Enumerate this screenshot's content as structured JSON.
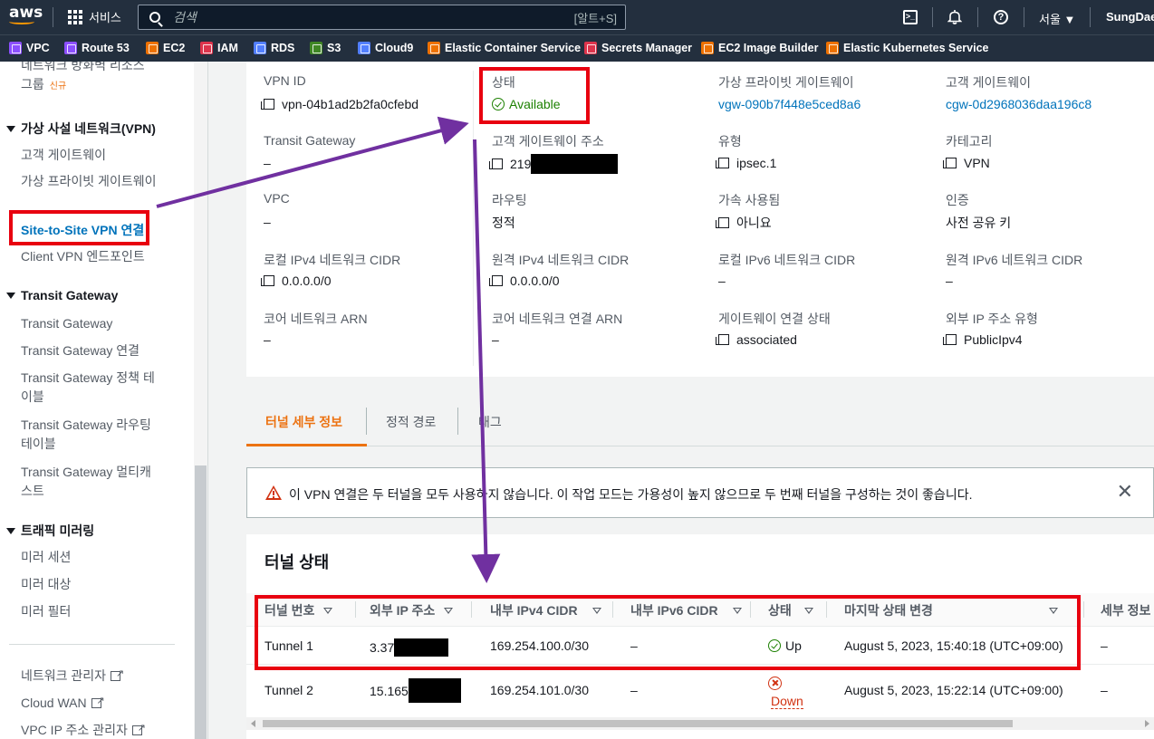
{
  "topnav": {
    "logo": "aws",
    "services_label": "서비스",
    "search_placeholder": "검색",
    "search_shortcut": "[알트+S]",
    "region": "서울 ▼",
    "user": "SungDae,"
  },
  "favorites": [
    {
      "label": "VPC",
      "color": "#8c4fff"
    },
    {
      "label": "Route 53",
      "color": "#8c4fff"
    },
    {
      "label": "EC2",
      "color": "#ed7100"
    },
    {
      "label": "IAM",
      "color": "#dd344c"
    },
    {
      "label": "RDS",
      "color": "#527fff"
    },
    {
      "label": "S3",
      "color": "#3f8624"
    },
    {
      "label": "Cloud9",
      "color": "#527fff"
    },
    {
      "label": "Elastic Container Service",
      "color": "#ed7100"
    },
    {
      "label": "Secrets Manager",
      "color": "#dd344c"
    },
    {
      "label": "EC2 Image Builder",
      "color": "#ed7100"
    },
    {
      "label": "Elastic Kubernetes Service",
      "color": "#ed7100"
    }
  ],
  "sidebar": {
    "traffic_reach_line1": "네트워크 방화벽 리소스",
    "traffic_reach_line2": "그룹",
    "new_badge": "신규",
    "vpn_section": "가상 사설 네트워크(VPN)",
    "vpn_items": [
      "고객 게이트웨이",
      "가상 프라이빗 게이트웨이",
      "Site-to-Site VPN 연결",
      "Client VPN 엔드포인트"
    ],
    "tgw_section": "Transit Gateway",
    "tgw_items": [
      "Transit Gateway",
      "Transit Gateway 연결",
      "Transit Gateway 정책 테이블",
      "Transit Gateway 라우팅 테이블",
      "Transit Gateway 멀티캐스트"
    ],
    "mirror_section": "트래픽 미러링",
    "mirror_items": [
      "미러 세션",
      "미러 대상",
      "미러 필터"
    ],
    "bottom_links": [
      "네트워크 관리자",
      "Cloud WAN",
      "VPC IP 주소 관리자"
    ]
  },
  "details": {
    "vpn_id_label": "VPN ID",
    "vpn_id": "vpn-04b1ad2b2fa0cfebd",
    "state_label": "상태",
    "state": "Available",
    "vgw_label": "가상 프라이빗 게이트웨이",
    "vgw": "vgw-090b7f448e5ced8a6",
    "cgw_label": "고객 게이트웨이",
    "cgw": "cgw-0d2968036daa196c8",
    "tgw_label": "Transit Gateway",
    "tgw": "–",
    "cgw_addr_label": "고객 게이트웨이 주소",
    "cgw_addr": "219",
    "type_label": "유형",
    "type": "ipsec.1",
    "category_label": "카테고리",
    "category": "VPN",
    "vpc_label": "VPC",
    "vpc": "–",
    "routing_label": "라우팅",
    "routing": "정적",
    "accel_label": "가속 사용됨",
    "accel": "아니요",
    "auth_label": "인증",
    "auth": "사전 공유 키",
    "local_v4_label": "로컬 IPv4 네트워크 CIDR",
    "local_v4": "0.0.0.0/0",
    "remote_v4_label": "원격 IPv4 네트워크 CIDR",
    "remote_v4": "0.0.0.0/0",
    "local_v6_label": "로컬 IPv6 네트워크 CIDR",
    "local_v6": "–",
    "remote_v6_label": "원격 IPv6 네트워크 CIDR",
    "remote_v6": "–",
    "core_arn_label": "코어 네트워크 ARN",
    "core_arn": "–",
    "core_attach_label": "코어 네트워크 연결 ARN",
    "core_attach": "–",
    "gw_assoc_label": "게이트웨이 연결 상태",
    "gw_assoc": "associated",
    "outside_ip_label": "외부 IP 주소 유형",
    "outside_ip": "PublicIpv4"
  },
  "tabs": [
    "터널 세부 정보",
    "정적 경로",
    "태그"
  ],
  "alert": {
    "text": "이 VPN 연결은 두 터널을 모두 사용하지 않습니다. 이 작업 모드는 가용성이 높지 않으므로 두 번째 터널을 구성하는 것이 좋습니다."
  },
  "tunnel": {
    "title": "터널 상태",
    "columns": [
      "터널 번호",
      "외부 IP 주소",
      "내부 IPv4 CIDR",
      "내부 IPv6 CIDR",
      "상태",
      "마지막 상태 변경",
      "세부 정보"
    ],
    "rows": [
      {
        "number": "Tunnel 1",
        "outside_ip": "3.37",
        "inside_v4": "169.254.100.0/30",
        "inside_v6": "–",
        "status": "Up",
        "last_change": "August 5, 2023, 15:40:18 (UTC+09:00)",
        "details": "–"
      },
      {
        "number": "Tunnel 2",
        "outside_ip": "15.165",
        "inside_v4": "169.254.101.0/30",
        "inside_v6": "–",
        "status": "Down",
        "last_change": "August 5, 2023, 15:22:14 (UTC+09:00)",
        "details": "–"
      }
    ]
  },
  "colors": {
    "annotation_red": "#e8000f",
    "annotation_arrow": "#7030a0",
    "status_green": "#1d8102",
    "status_red": "#d13212",
    "link": "#0073bb",
    "tab_active": "#ec7211"
  }
}
